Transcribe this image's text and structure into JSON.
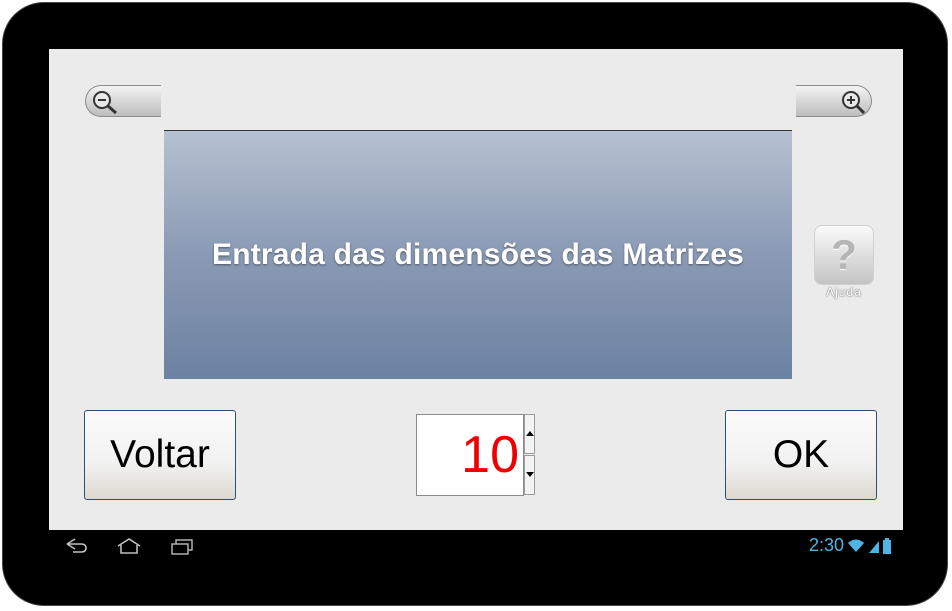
{
  "header": {
    "title": "Entrada das dimensões das Matrizes"
  },
  "help": {
    "icon_char": "?",
    "label": "Ajuda"
  },
  "buttons": {
    "back_label": "Voltar",
    "ok_label": "OK"
  },
  "spinner": {
    "value": "10"
  },
  "zoom": {
    "out_icon": "zoom-out-icon",
    "in_icon": "zoom-in-icon"
  },
  "status_bar": {
    "time": "2:30"
  },
  "colors": {
    "spinner_text": "#ee0000",
    "status_accent": "#4fb4e4",
    "button_border": "#2c4f78"
  }
}
